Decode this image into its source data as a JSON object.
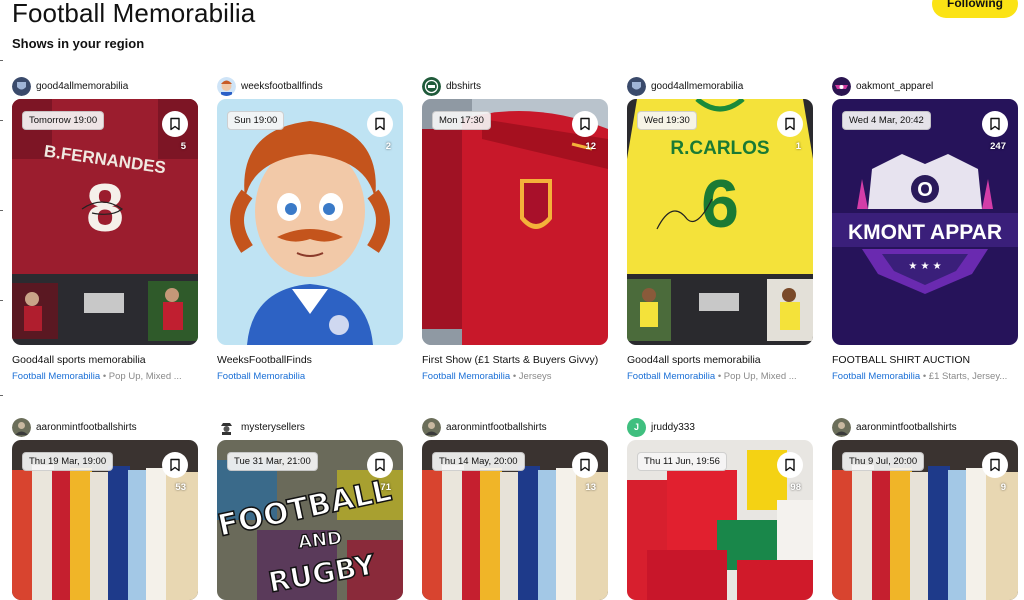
{
  "page": {
    "title": "Football Memorabilia",
    "section_title": "Shows in your region",
    "follow_label": "Following"
  },
  "colors": {
    "accent": "#fbe315",
    "link": "#1a6fd6",
    "muted": "#8a8a8a"
  },
  "cards": [
    {
      "seller": "good4allmemorabilia",
      "avatar_icon": "shield-avatar-icon",
      "time": "Tomorrow 19:00",
      "count": "5",
      "title": "Good4all sports memorabilia",
      "category": "Football Memorabilia",
      "tags": " • Pop Up, Mixed ..."
    },
    {
      "seller": "weeksfootballfinds",
      "avatar_icon": "cartoon-avatar-icon",
      "time": "Sun 19:00",
      "count": "2",
      "title": "WeeksFootballFinds",
      "category": "Football Memorabilia",
      "tags": ""
    },
    {
      "seller": "dbshirts",
      "avatar_icon": "db-logo-avatar-icon",
      "time": "Mon 17:30",
      "count": "12",
      "title": "First Show (£1 Starts & Buyers Givvy)",
      "category": "Football Memorabilia",
      "tags": " • Jerseys"
    },
    {
      "seller": "good4allmemorabilia",
      "avatar_icon": "shield-avatar-icon",
      "time": "Wed 19:30",
      "count": "1",
      "title": "Good4all sports memorabilia",
      "category": "Football Memorabilia",
      "tags": " • Pop Up, Mixed ..."
    },
    {
      "seller": "oakmont_apparel",
      "avatar_icon": "oakmont-avatar-icon",
      "time": "Wed 4 Mar, 20:42",
      "count": "247",
      "title": "FOOTBALL SHIRT AUCTION",
      "category": "Football Memorabilia",
      "tags": " • £1 Starts, Jersey..."
    },
    {
      "seller": "aaronmintfootballshirts",
      "avatar_icon": "photo-avatar-icon",
      "time": "Thu 19 Mar, 19:00",
      "count": "53",
      "title": "",
      "category": "",
      "tags": ""
    },
    {
      "seller": "mysterysellers",
      "avatar_icon": "mystery-avatar-icon",
      "time": "Tue 31 Mar, 21:00",
      "count": "71",
      "title": "",
      "category": "",
      "tags": ""
    },
    {
      "seller": "aaronmintfootballshirts",
      "avatar_icon": "photo-avatar-icon",
      "time": "Thu 14 May, 20:00",
      "count": "13",
      "title": "",
      "category": "",
      "tags": ""
    },
    {
      "seller": "jruddy333",
      "avatar_icon": "letter-j-avatar-icon",
      "avatar_letter": "J",
      "time": "Thu 11 Jun, 19:56",
      "count": "98",
      "title": "",
      "category": "",
      "tags": ""
    },
    {
      "seller": "aaronmintfootballshirts",
      "avatar_icon": "photo-avatar-icon",
      "time": "Thu 9 Jul, 20:00",
      "count": "9",
      "title": "",
      "category": "",
      "tags": ""
    }
  ],
  "artwork_text": {
    "fernandes_name": "B.FERNANDES",
    "fernandes_number": "8",
    "carlos_name": "R.CARLOS",
    "carlos_number": "6",
    "oakmont_banner": "KMONT APPAR",
    "oakmont_letter": "O",
    "mystery_line1": "FOOTBALL",
    "mystery_line2": "AND",
    "mystery_line3": "RUGBY"
  }
}
